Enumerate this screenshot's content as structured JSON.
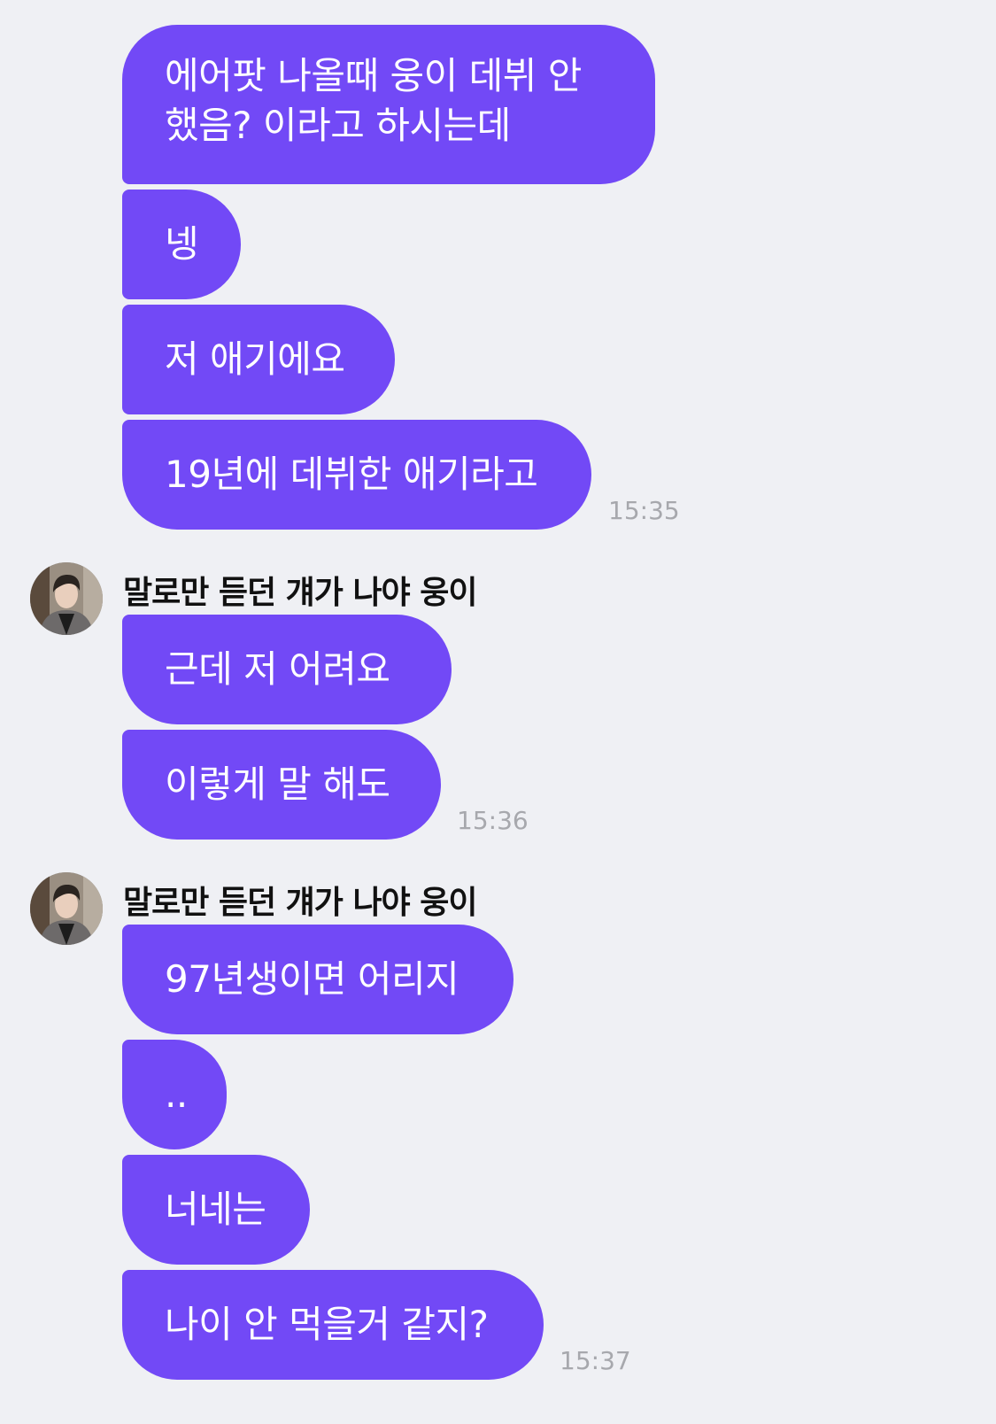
{
  "conversation": {
    "groups": [
      {
        "sender": "",
        "messages": [
          "에어팟 나올때 웅이 데뷔 안 했음? 이라고 하시는데",
          "넹",
          "저 애기에요",
          "19년에 데뷔한 애기라고"
        ],
        "time": "15:35"
      },
      {
        "sender": "말로만 듣던 걔가 나야 웅이",
        "avatar_icon": "profile-photo",
        "messages": [
          "근데 저 어려요",
          "이렇게 말 해도"
        ],
        "time": "15:36"
      },
      {
        "sender": "말로만 듣던 걔가 나야 웅이",
        "avatar_icon": "profile-photo",
        "messages": [
          "97년생이면 어리지",
          "..",
          "너네는",
          "나이 안 먹을거 같지?"
        ],
        "time": "15:37"
      }
    ]
  },
  "colors": {
    "bubble": "#7249f6",
    "background": "#eff0f4",
    "timestamp": "#a7a8ad"
  }
}
